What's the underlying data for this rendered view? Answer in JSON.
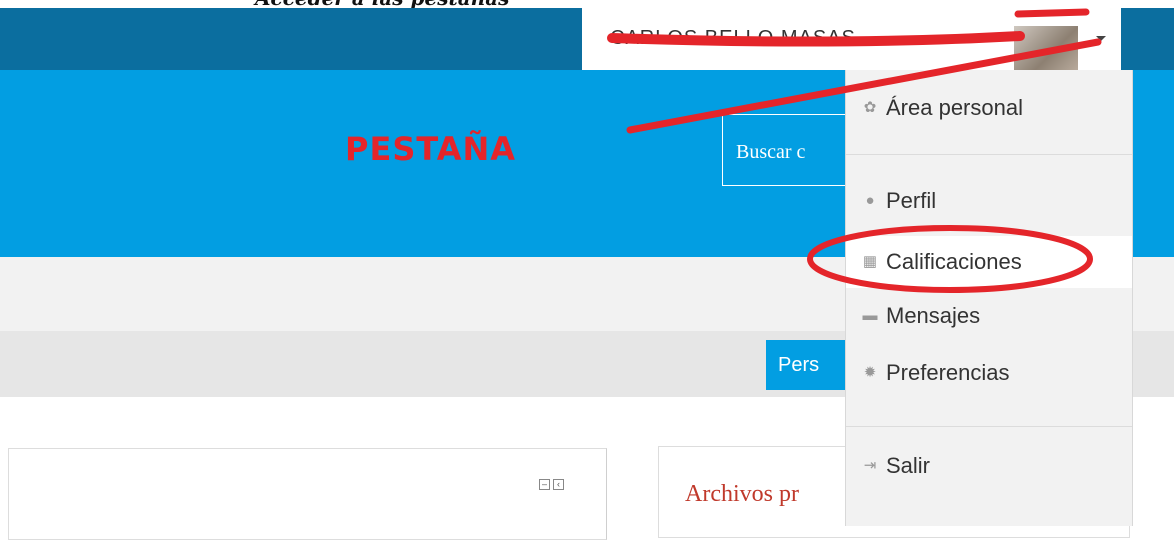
{
  "topbar": {
    "username": "CARLOS BELLO MASAS",
    "caption_text": "Acceder a las pestañas"
  },
  "banner": {
    "annotation": "PESTAÑA",
    "search_placeholder": "Buscar c"
  },
  "nav": {
    "active_tab": "Pers"
  },
  "dropdown": {
    "items": [
      {
        "label": "Área personal",
        "icon": "dashboard-icon"
      },
      {
        "label": "Perfil",
        "icon": "user-icon"
      },
      {
        "label": "Calificaciones",
        "icon": "grades-table-icon"
      },
      {
        "label": "Mensajes",
        "icon": "message-icon"
      },
      {
        "label": "Preferencias",
        "icon": "gear-icon"
      },
      {
        "label": "Salir",
        "icon": "logout-icon"
      }
    ]
  },
  "blocks": {
    "right_title": "Archivos pr"
  },
  "colors": {
    "topbar": "#0b6e9f",
    "banner": "#029ee2",
    "annotation_red": "#e4252a"
  }
}
